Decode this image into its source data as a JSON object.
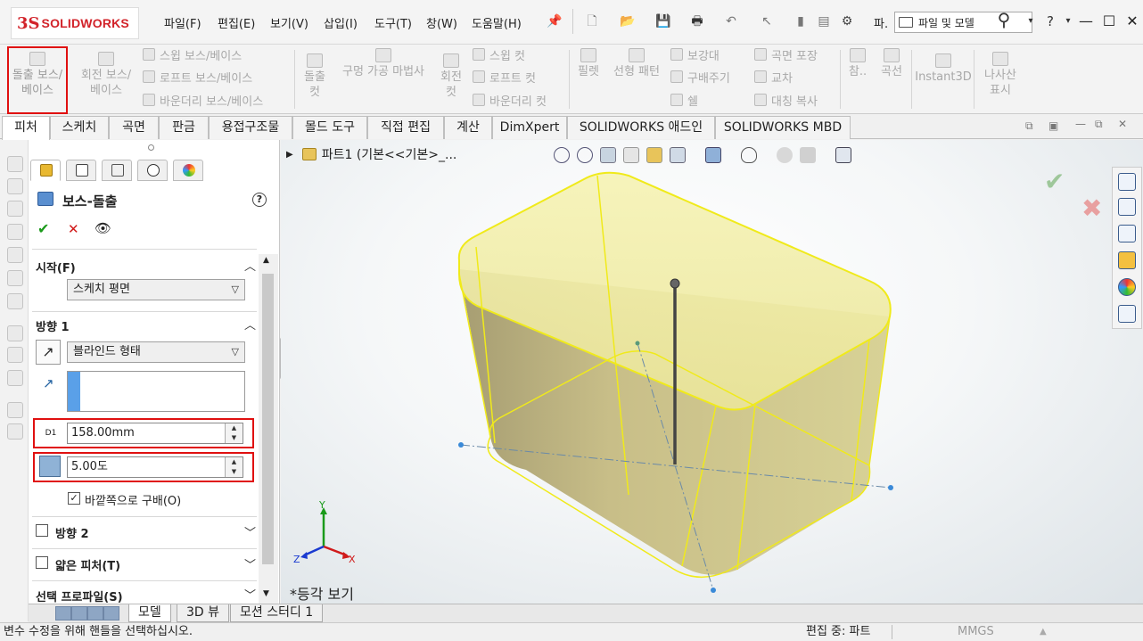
{
  "app": {
    "logo_mark": "3S",
    "logo_text": "SOLIDWORKS"
  },
  "menu": [
    "파일(F)",
    "편집(E)",
    "보기(V)",
    "삽입(I)",
    "도구(T)",
    "창(W)",
    "도움말(H)"
  ],
  "quick_access": {
    "truncated_label": "파.",
    "search_label": "파일 및 모델"
  },
  "ribbon": {
    "extrude_boss": [
      "돌출 보스/",
      "베이스"
    ],
    "revolve_boss": [
      "회전 보스/",
      "베이스"
    ],
    "swept_boss": "스윕 보스/베이스",
    "loft_boss": "로프트 보스/베이스",
    "boundary_boss": "바운더리 보스/베이스",
    "extrude_cut": [
      "돌출",
      "컷"
    ],
    "hole_wizard": "구멍 가공 마법사",
    "revolve_cut": [
      "회전",
      "컷"
    ],
    "swept_cut": "스윕 컷",
    "loft_cut": "로프트 컷",
    "boundary_cut": "바운더리 컷",
    "fillet": "필렛",
    "linear_pattern": "선형 패턴",
    "rib": "보강대",
    "draft": "구배주기",
    "shell": "쉘",
    "wrap": "곡면 포장",
    "intersect": "교차",
    "mirror": "대칭 복사",
    "reference": "참..",
    "curves": "곡선",
    "instant3d": "Instant3D",
    "helix": [
      "나사산",
      "표시"
    ]
  },
  "command_tabs": [
    "피처",
    "스케치",
    "곡면",
    "판금",
    "용접구조물",
    "몰드 도구",
    "직접 편집",
    "계산",
    "DimXpert",
    "SOLIDWORKS 애드인",
    "SOLIDWORKS MBD"
  ],
  "property_manager": {
    "title": "보스-돌출",
    "from_label": "시작(F)",
    "from_value": "스케치 평면",
    "dir1_label": "방향 1",
    "end_condition": "블라인드 형태",
    "depth_value": "158.00mm",
    "draft_value": "5.00도",
    "draft_outward_label": "바깥쪽으로 구배(O)",
    "dir2_label": "방향 2",
    "thin_label": "얇은 피처(T)",
    "selected_profiles_label": "선택 프로파일(S)",
    "depth_icon_text": "D1"
  },
  "tree": {
    "label": "파트1  (기본<<기본>_..."
  },
  "viewport": {
    "view_label": "*등각 보기"
  },
  "model_tabs": [
    "모델",
    "3D 뷰",
    "모션 스터디 1"
  ],
  "status": {
    "message": "변수 수정을 위해 핸들을 선택하십시오.",
    "mode": "편집 중: 파트",
    "units": "MMGS"
  },
  "triad": {
    "x": "X",
    "y": "Y",
    "z": "Z"
  },
  "colors": {
    "accent_red": "#e01010",
    "model_yellow": "#f2ee7e",
    "edge_yellow": "#f0ea1a"
  }
}
